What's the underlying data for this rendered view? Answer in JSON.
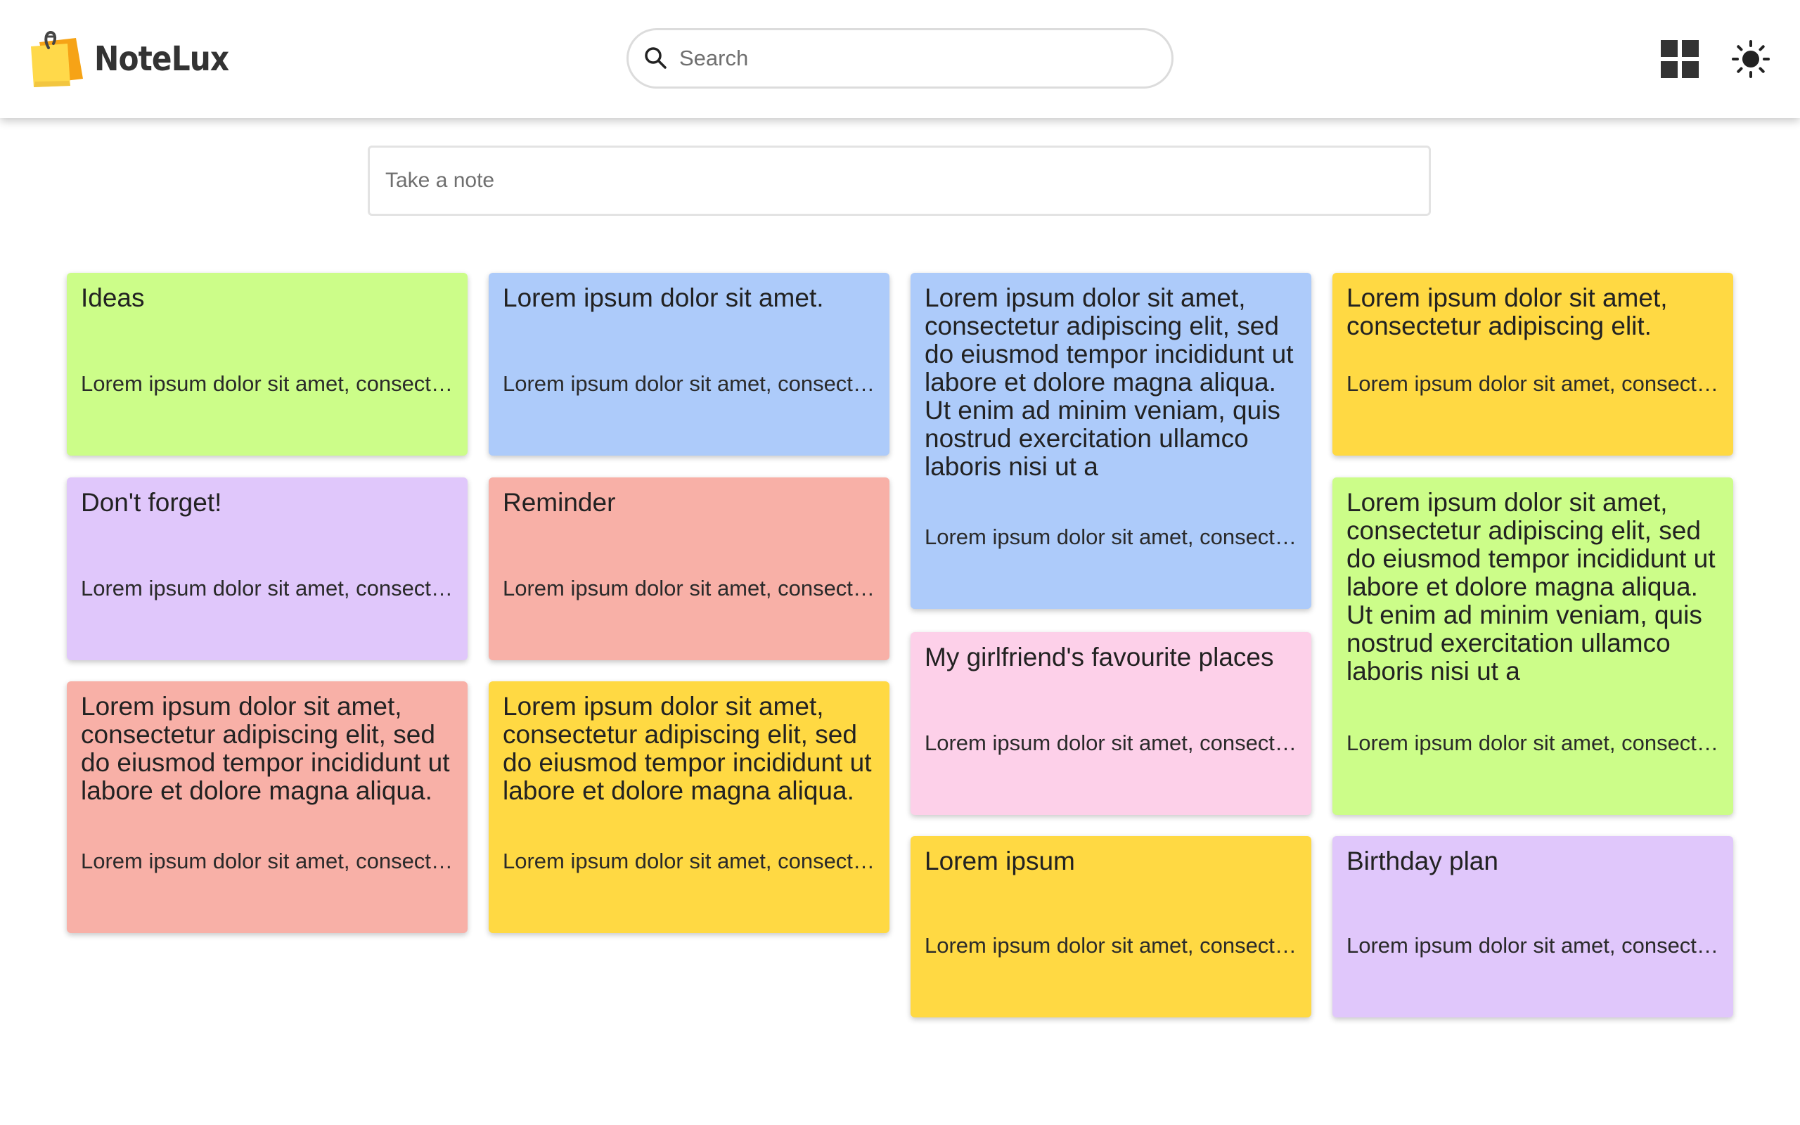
{
  "app": {
    "name": "NoteLux"
  },
  "search": {
    "placeholder": "Search"
  },
  "composer": {
    "placeholder": "Take a note"
  },
  "colors": {
    "green": "#ccfd89",
    "blue": "#adcbfa",
    "yellow": "#ffd943",
    "purple": "#e0c7fb",
    "red": "#f8b0a7",
    "pink": "#fdd0e9"
  },
  "icons": {
    "logo": "sticky-note-logo-icon",
    "search": "search-icon",
    "layout": "grid-view-icon",
    "theme": "sun-icon"
  },
  "notes": [
    {
      "title": "Ideas",
      "body": "Lorem ipsum dolor sit amet, consectetur adipiscing elit",
      "color": "green"
    },
    {
      "title": "Don't forget!",
      "body": "Lorem ipsum dolor sit amet, consectetur adipiscing elit",
      "color": "purple"
    },
    {
      "title": "Lorem ipsum dolor sit amet, consectetur adipiscing elit, sed do eiusmod tempor incididunt ut labore et dolore magna aliqua.",
      "body": "Lorem ipsum dolor sit amet, consectetur adipiscing elit",
      "color": "red"
    },
    {
      "title": "Lorem ipsum dolor sit amet.",
      "body": "Lorem ipsum dolor sit amet, consectetur adipiscing elit",
      "color": "blue"
    },
    {
      "title": "Reminder",
      "body": "Lorem ipsum dolor sit amet, consectetur adipiscing elit",
      "color": "red"
    },
    {
      "title": "Lorem ipsum dolor sit amet, consectetur adipiscing elit, sed do eiusmod tempor incididunt ut labore et dolore magna aliqua.",
      "body": "Lorem ipsum dolor sit amet, consectetur adipiscing elit",
      "color": "yellow"
    },
    {
      "title": "Lorem ipsum dolor sit amet, consectetur adipiscing elit, sed do eiusmod tempor incididunt ut labore et dolore magna aliqua. Ut enim ad minim veniam, quis nostrud exercitation ullamco laboris nisi ut a",
      "body": "Lorem ipsum dolor sit amet, consectetur adipiscing elit",
      "color": "blue"
    },
    {
      "title": "My girlfriend's favourite places",
      "body": "Lorem ipsum dolor sit amet, consectetur adipiscing elit",
      "color": "pink"
    },
    {
      "title": "Lorem ipsum",
      "body": "Lorem ipsum dolor sit amet, consectetur adipiscing elit",
      "color": "yellow"
    },
    {
      "title": "Lorem ipsum dolor sit amet, consectetur adipiscing elit.",
      "body": "Lorem ipsum dolor sit amet, consectetur adipiscing elit",
      "color": "yellow"
    },
    {
      "title": "Lorem ipsum dolor sit amet, consectetur adipiscing elit, sed do eiusmod tempor incididunt ut labore et dolore magna aliqua. Ut enim ad minim veniam, quis nostrud exercitation ullamco laboris nisi ut a",
      "body": "Lorem ipsum dolor sit amet, consectetur adipiscing elit",
      "color": "green"
    },
    {
      "title": "Birthday plan",
      "body": "Lorem ipsum dolor sit amet, consectetur adipiscing elit",
      "color": "purple"
    }
  ]
}
